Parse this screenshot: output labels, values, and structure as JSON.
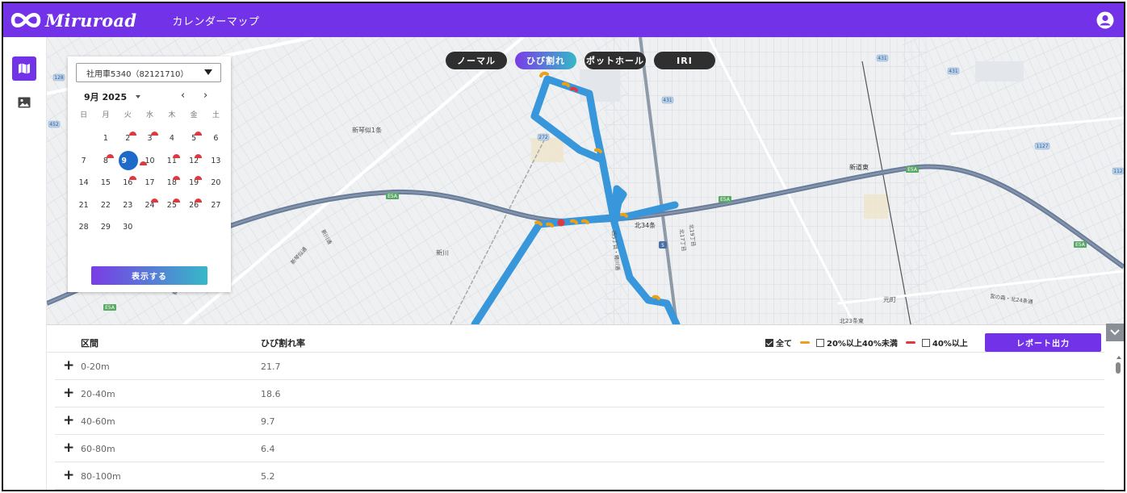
{
  "app": {
    "logo_text": "Miruroad",
    "page_title": "カレンダーマップ"
  },
  "mode_tabs": [
    {
      "label": "ノーマル",
      "active": false
    },
    {
      "label": "ひび割れ",
      "active": true
    },
    {
      "label": "ポットホール",
      "active": false
    },
    {
      "label": "IRI",
      "active": false
    }
  ],
  "calendar": {
    "vehicle": "社用車5340（82121710）",
    "month_label": "9月 2025",
    "weekdays": [
      "日",
      "月",
      "火",
      "水",
      "木",
      "金",
      "土"
    ],
    "leading_blank_days": 1,
    "days": [
      "1",
      "2",
      "3",
      "4",
      "5",
      "6",
      "7",
      "8",
      "9",
      "10",
      "11",
      "12",
      "13",
      "14",
      "15",
      "16",
      "17",
      "18",
      "19",
      "20",
      "21",
      "22",
      "23",
      "24",
      "25",
      "26",
      "27",
      "28",
      "29",
      "30"
    ],
    "marked_days": [
      "2",
      "3",
      "5",
      "8",
      "9",
      "11",
      "12",
      "16",
      "18",
      "19",
      "24",
      "25",
      "26"
    ],
    "selected_day": "9",
    "show_button": "表示する"
  },
  "map_labels": {
    "district_1": "新琴似1条",
    "district_2": "新川",
    "district_3": "北34条",
    "district_4": "新道東",
    "district_5": "元町",
    "district_6": "北23条東",
    "road_1": "新川通",
    "road_2": "新琴似通",
    "road_3": "西5丁目・樽川通",
    "road_4": "北17丁目",
    "road_5": "北19丁目",
    "road_6": "宮の森・北24条通",
    "road_7": "新琴似",
    "shield_1": "128",
    "shield_2": "452",
    "shield_3": "431",
    "shield_4": "431",
    "shield_5": "431",
    "shield_6": "1127",
    "shield_7": "112",
    "shield_8": "272",
    "shield_9": "5",
    "expressway_1": "E5A",
    "expressway_2": "E5A",
    "expressway_3": "E5A",
    "expressway_4": "E5A",
    "expressway_5": "E5A"
  },
  "table": {
    "col_section": "区間",
    "col_rate": "ひび割れ率",
    "filter_all": "全て",
    "filter_mid": "20%以上40%未満",
    "filter_high": "40%以上",
    "report_button": "レポート出力",
    "rows": [
      {
        "section": "0-20m",
        "rate": "21.7"
      },
      {
        "section": "20-40m",
        "rate": "18.6"
      },
      {
        "section": "40-60m",
        "rate": "9.7"
      },
      {
        "section": "60-80m",
        "rate": "6.4"
      },
      {
        "section": "80-100m",
        "rate": "5.2"
      }
    ]
  },
  "colors": {
    "brand": "#7232e8",
    "route": "#3896da",
    "crack_mid": "#e9a11c",
    "crack_high": "#e0383e",
    "selected_day": "#1e6ac8",
    "expressway": "#6a7c97"
  },
  "icons": {
    "logo": "infinity-icon",
    "user": "user-circle-icon",
    "map_nav": "map-icon",
    "image_nav": "image-icon",
    "collapse": "chevron-down-icon"
  }
}
